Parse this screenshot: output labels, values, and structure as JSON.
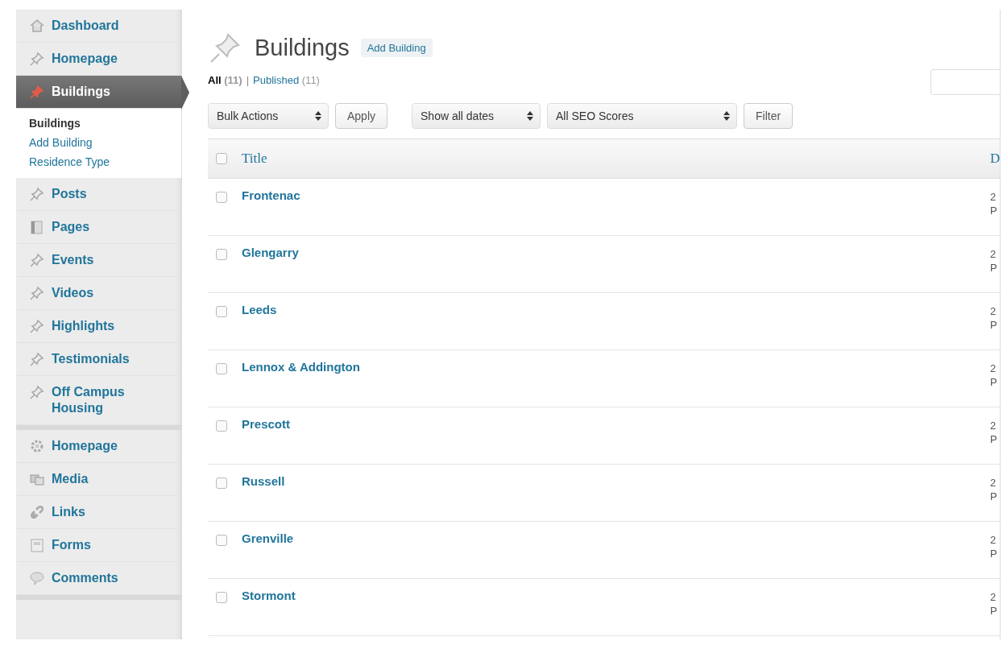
{
  "sidebar": {
    "groups": [
      [
        {
          "label": "Dashboard",
          "kind": "dashboard",
          "selected": false
        },
        {
          "label": "Homepage",
          "kind": "pin",
          "selected": false
        },
        {
          "label": "Buildings",
          "kind": "pin",
          "selected": true,
          "children": [
            {
              "label": "Buildings",
              "selected": true
            },
            {
              "label": "Add Building",
              "selected": false
            },
            {
              "label": "Residence Type",
              "selected": false
            }
          ]
        },
        {
          "label": "Posts",
          "kind": "pin",
          "selected": false
        },
        {
          "label": "Pages",
          "kind": "pages",
          "selected": false
        },
        {
          "label": "Events",
          "kind": "pin",
          "selected": false
        },
        {
          "label": "Videos",
          "kind": "pin",
          "selected": false
        },
        {
          "label": "Highlights",
          "kind": "pin",
          "selected": false
        },
        {
          "label": "Testimonials",
          "kind": "pin",
          "selected": false
        },
        {
          "label": "Off Campus Housing",
          "kind": "pin",
          "selected": false
        }
      ],
      [
        {
          "label": "Homepage",
          "kind": "gear",
          "selected": false
        },
        {
          "label": "Media",
          "kind": "media",
          "selected": false
        },
        {
          "label": "Links",
          "kind": "links",
          "selected": false
        },
        {
          "label": "Forms",
          "kind": "forms",
          "selected": false
        },
        {
          "label": "Comments",
          "kind": "comments",
          "selected": false
        }
      ]
    ]
  },
  "header": {
    "title": "Buildings",
    "add_button": "Add Building"
  },
  "views": [
    {
      "label": "All",
      "count": "(11)",
      "selected": true
    },
    {
      "label": "Published",
      "count": "(11)",
      "selected": false
    }
  ],
  "separator": "|",
  "toolbar": {
    "bulk_select": "Bulk Actions",
    "apply": "Apply",
    "date_select": "Show all dates",
    "seo_select": "All SEO Scores",
    "filter": "Filter"
  },
  "table": {
    "columns": [
      "Title",
      "D"
    ],
    "select_all_checked": false,
    "rows": [
      {
        "title": "Frontenac",
        "column_2": "2",
        "column_2b": "P",
        "checked": false
      },
      {
        "title": "Glengarry",
        "column_2": "2",
        "column_2b": "P",
        "checked": false
      },
      {
        "title": "Leeds",
        "column_2": "2",
        "column_2b": "P",
        "checked": false
      },
      {
        "title": "Lennox & Addington",
        "column_2": "2",
        "column_2b": "P",
        "checked": false
      },
      {
        "title": "Prescott",
        "column_2": "2",
        "column_2b": "P",
        "checked": false
      },
      {
        "title": "Russell",
        "column_2": "2",
        "column_2b": "P",
        "checked": false
      },
      {
        "title": "Grenville",
        "column_2": "2",
        "column_2b": "P",
        "checked": false
      },
      {
        "title": "Stormont",
        "column_2": "2",
        "column_2b": "P",
        "checked": false
      }
    ]
  }
}
